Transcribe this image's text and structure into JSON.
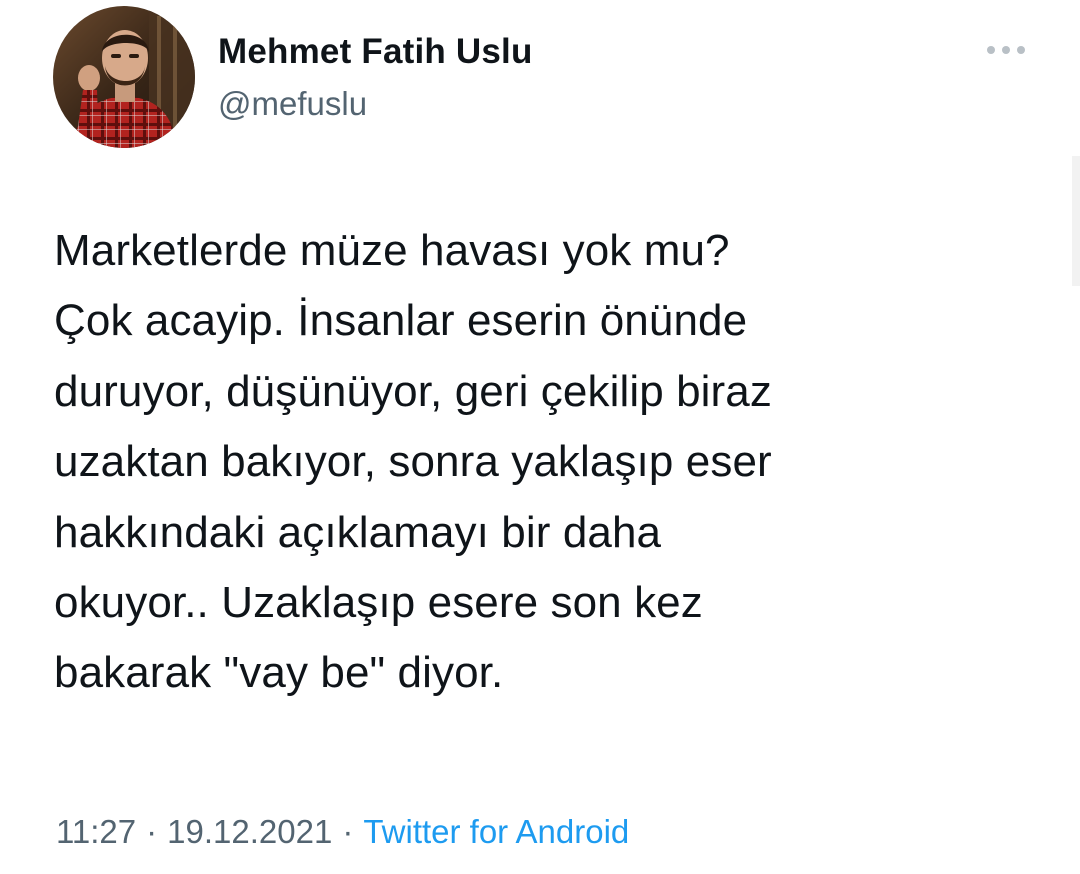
{
  "tweet": {
    "author": {
      "display_name": "Mehmet Fatih Uslu",
      "handle": "@mefuslu"
    },
    "text": "Marketlerde müze havası yok mu?\nÇok acayip. İnsanlar eserin önünde\nduruyor, düşünüyor, geri çekilip biraz\nuzaktan bakıyor, sonra yaklaşıp eser\nhakkındaki açıklamayı bir daha\nokuyor.. Uzaklaşıp esere son kez\nbakarak \"vay be\" diyor.",
    "meta": {
      "time": "11:27",
      "separator": "·",
      "date": "19.12.2021",
      "source": "Twitter for Android"
    }
  },
  "icons": {
    "more": "more-horizontal-icon"
  },
  "colors": {
    "text_primary": "#0f1419",
    "text_secondary": "#536471",
    "link": "#1d9bf0",
    "background": "#ffffff"
  }
}
